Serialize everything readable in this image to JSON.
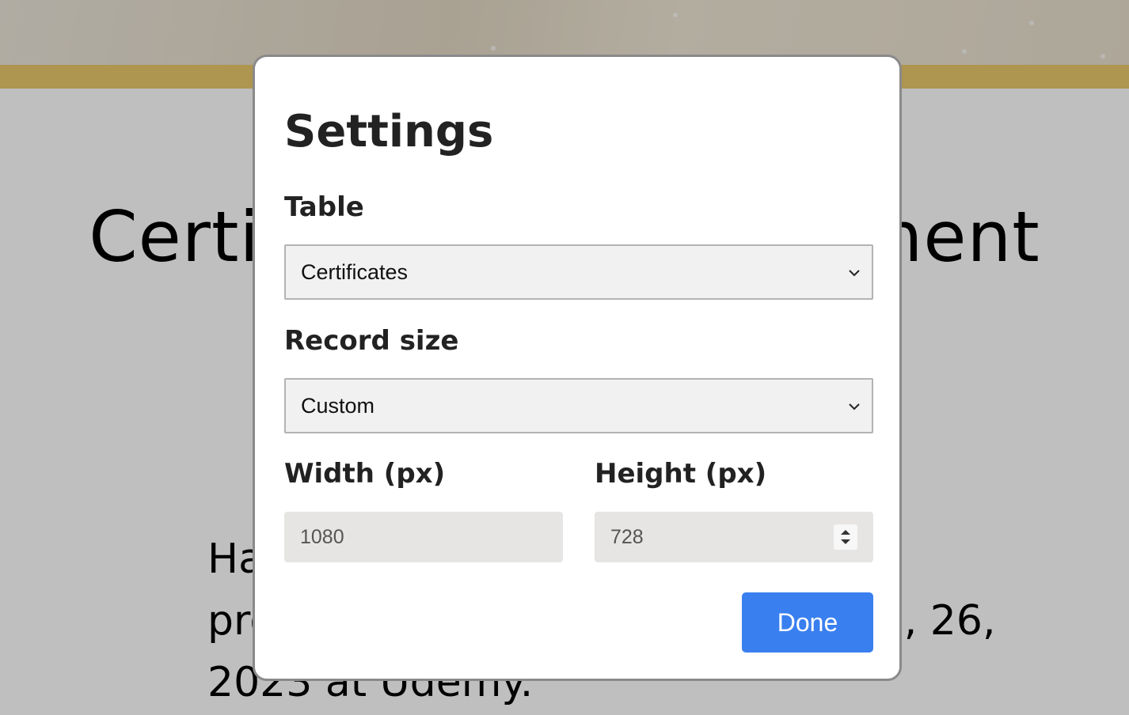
{
  "background": {
    "title": "Certificate of Achievement",
    "body": "Has successfully completed the program for the course as of April, 26, 2023 at Udemy."
  },
  "settings": {
    "title": "Settings",
    "table": {
      "label": "Table",
      "value": "Certificates",
      "icon": "chevron-down-icon"
    },
    "record_size": {
      "label": "Record size",
      "value": "Custom",
      "icon": "chevron-down-icon"
    },
    "width": {
      "label": "Width (px)",
      "value": "1080"
    },
    "height": {
      "label": "Height (px)",
      "value": "728",
      "icon": "spinner-arrows-icon"
    },
    "done_label": "Done"
  },
  "colors": {
    "accent": "#3a7ff0",
    "gold": "#e9c76b",
    "overlay": "rgba(0,0,0,0.25)"
  }
}
